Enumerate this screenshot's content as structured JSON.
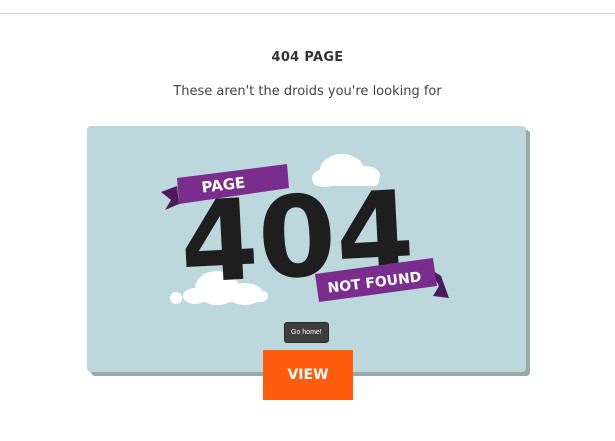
{
  "page": {
    "heading": "404 PAGE",
    "subheading": "These aren't the droids you're looking for"
  },
  "preview": {
    "ribbon_top": "PAGE",
    "big_number": "404",
    "ribbon_bottom": "NOT FOUND",
    "button_label": "Go home!"
  },
  "cta": {
    "label": "VIEW"
  },
  "colors": {
    "accent": "#ff5d0e",
    "ribbon": "#7b2d8e",
    "card_bg": "#bcd8dc",
    "number": "#1e1e1e"
  }
}
